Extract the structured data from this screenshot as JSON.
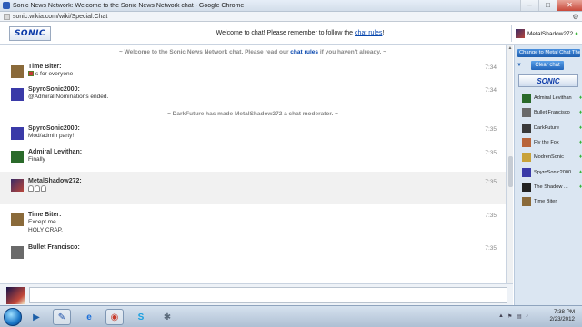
{
  "browser": {
    "title": "Sonic News Network: Welcome to the Sonic News Network chat - Google Chrome",
    "url": "sonic.wikia.com/wiki/Special:Chat",
    "menu_icon": "wrench-icon",
    "min_label": "–",
    "max_label": "□",
    "close_label": "✕"
  },
  "header": {
    "logo_text": "SONIC",
    "welcome_text": "Welcome to chat! Please remember to follow the",
    "welcome_link": "chat rules",
    "welcome_end": "!",
    "me_name": "MetalShadow272"
  },
  "alerts": {
    "welcome_pre": "~ Welcome to the Sonic News Network chat. Please read our",
    "welcome_link": "chat rules",
    "welcome_post": "if you haven't already. ~",
    "mod_notice": "~ DarkFuture has made MetalShadow272 a chat moderator. ~"
  },
  "messages": [
    {
      "user": "Time Biter:",
      "text": "s for everyone",
      "time": "7:34",
      "avatar_color": "#8a6a3a"
    },
    {
      "user": "SpyroSonic2000:",
      "text": "@Admiral Nominations ended.",
      "time": "7:34",
      "avatar_color": "#3a3aa8"
    },
    {
      "user": "SpyroSonic2000:",
      "text": "Mod/admin party!",
      "time": "7:35",
      "avatar_color": "#3a3aa8"
    },
    {
      "user": "Admiral Levithan:",
      "text": "Finally",
      "time": "7:35",
      "avatar_color": "#2a6a2a"
    },
    {
      "user": "MetalShadow272:",
      "text": "",
      "time": "7:35",
      "avatar_color": "#3a2b66"
    },
    {
      "user": "Time Biter:",
      "text": "Except me.",
      "text2": "HOLY CRAP.",
      "time": "7:35",
      "avatar_color": "#8a6a3a"
    },
    {
      "user": "Bullet Francisco:",
      "text": "",
      "time": "7:35",
      "avatar_color": "#6a6a6a"
    }
  ],
  "rail": {
    "button_label": "Change to Metal Chat Theme",
    "clear_label": "Clear chat",
    "logo_text": "SONIC",
    "users": [
      {
        "name": "Admiral Levithan",
        "color": "#2a6a2a"
      },
      {
        "name": "Bullet Francisco",
        "color": "#6a6a6a"
      },
      {
        "name": "DarkFuture",
        "color": "#3a3a3a"
      },
      {
        "name": "Fly the Fox",
        "color": "#b8643a"
      },
      {
        "name": "ModrenSonic",
        "color": "#c8a23a"
      },
      {
        "name": "SpyroSonic2000",
        "color": "#3a3aa8"
      },
      {
        "name": "The Shadow ...",
        "color": "#222222"
      },
      {
        "name": "Time Biter",
        "color": "#8a6a3a"
      }
    ]
  },
  "taskbar": {
    "time": "7:38 PM",
    "date": "2/23/2012"
  }
}
